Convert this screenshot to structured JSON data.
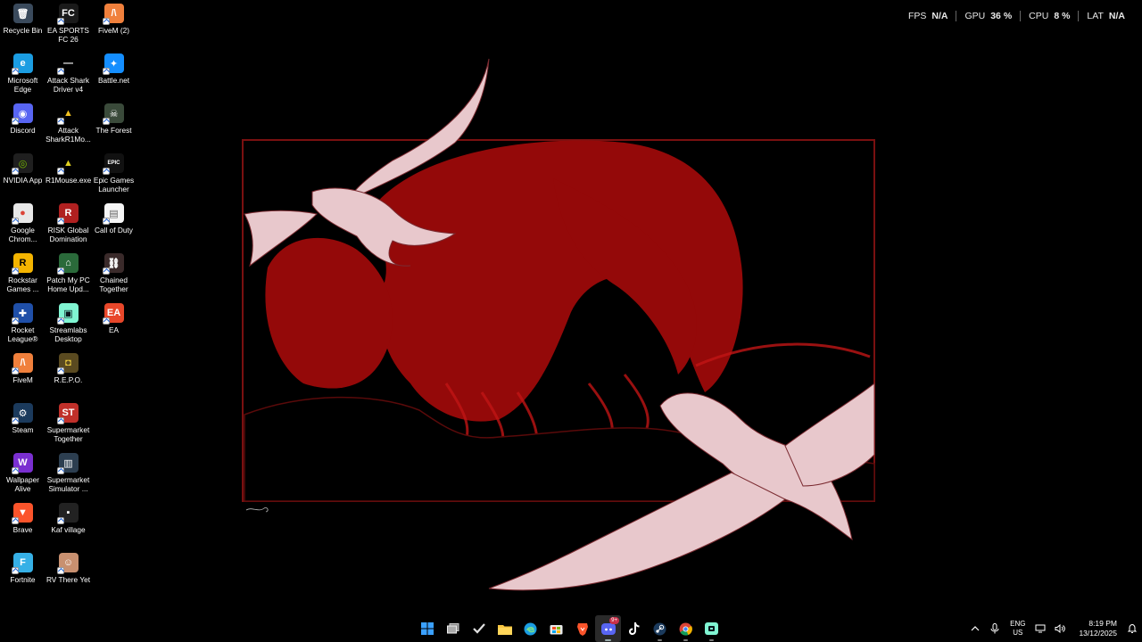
{
  "desktop": {
    "icons": [
      {
        "label": "Recycle Bin",
        "icon": "recycle-bin-icon",
        "bg": "#3a4a5c",
        "glyph": "🗑"
      },
      {
        "label": "Microsoft Edge",
        "icon": "edge-icon",
        "bg": "#1b9de2",
        "glyph": "e"
      },
      {
        "label": "Discord",
        "icon": "discord-icon",
        "bg": "#5865f2",
        "glyph": "◉"
      },
      {
        "label": "NVIDIA App",
        "icon": "nvidia-icon",
        "bg": "#1f1f1f",
        "glyph": "◎",
        "color": "#76b900"
      },
      {
        "label": "Google Chrom...",
        "icon": "chrome-icon",
        "bg": "#e8e8e8",
        "glyph": "●",
        "color": "#db4437"
      },
      {
        "label": "Rockstar Games ...",
        "icon": "rockstar-icon",
        "bg": "#f4b400",
        "glyph": "R",
        "color": "#000"
      },
      {
        "label": "Rocket League®",
        "icon": "rocket-league-icon",
        "bg": "#1f4fa8",
        "glyph": "✚"
      },
      {
        "label": "FiveM",
        "icon": "fivem-icon",
        "bg": "#f0803c",
        "glyph": "/\\"
      },
      {
        "label": "Steam",
        "icon": "steam-icon",
        "bg": "#1b3a5c",
        "glyph": "⚙"
      },
      {
        "label": "Wallpaper Alive",
        "icon": "wallpaper-alive-icon",
        "bg": "#7a2fd0",
        "glyph": "W"
      },
      {
        "label": "Brave",
        "icon": "brave-icon",
        "bg": "#fb542b",
        "glyph": "▼"
      },
      {
        "label": "Fortnite",
        "icon": "fortnite-icon",
        "bg": "#36b0e6",
        "glyph": "F"
      },
      {
        "label": "EA SPORTS FC 26",
        "icon": "ea-sports-fc-icon",
        "bg": "#1a1a1a",
        "glyph": "FC"
      },
      {
        "label": "Attack Shark Driver v4",
        "icon": "attack-shark-driver-icon",
        "bg": "#000",
        "glyph": "—"
      },
      {
        "label": "Attack SharkR1Mo...",
        "icon": "attack-shark-r1-icon",
        "bg": "#000",
        "glyph": "▲",
        "color": "#f0c020"
      },
      {
        "label": "R1Mouse.exe",
        "icon": "r1mouse-icon",
        "bg": "#000",
        "glyph": "▲",
        "color": "#e0d020"
      },
      {
        "label": "RISK Global Domination",
        "icon": "risk-icon",
        "bg": "#b02020",
        "glyph": "R"
      },
      {
        "label": "Patch My PC Home Upd...",
        "icon": "patch-my-pc-icon",
        "bg": "#2a6a3a",
        "glyph": "⌂"
      },
      {
        "label": "Streamlabs Desktop",
        "icon": "streamlabs-icon",
        "bg": "#80f5d2",
        "glyph": "▣",
        "color": "#09161d"
      },
      {
        "label": "R.E.P.O.",
        "icon": "repo-icon",
        "bg": "#5a4a20",
        "glyph": "◘",
        "color": "#f0d040"
      },
      {
        "label": "Supermarket Together",
        "icon": "supermarket-together-icon",
        "bg": "#c0302a",
        "glyph": "ST"
      },
      {
        "label": "Supermarket Simulator ...",
        "icon": "supermarket-simulator-icon",
        "bg": "#2c3e50",
        "glyph": "▥"
      },
      {
        "label": "Kaf village",
        "icon": "kaf-village-icon",
        "bg": "#222",
        "glyph": "▪"
      },
      {
        "label": "RV There Yet",
        "icon": "rv-there-yet-icon",
        "bg": "#c89070",
        "glyph": "☺"
      },
      {
        "label": "FiveM (2)",
        "icon": "fivem-icon",
        "bg": "#f0803c",
        "glyph": "/\\"
      },
      {
        "label": "Battle.net",
        "icon": "battlenet-icon",
        "bg": "#148eff",
        "glyph": "✦"
      },
      {
        "label": "The Forest",
        "icon": "the-forest-icon",
        "bg": "#3a4a3a",
        "glyph": "☠"
      },
      {
        "label": "Epic Games Launcher",
        "icon": "epic-games-icon",
        "bg": "#111",
        "glyph": "EPIC"
      },
      {
        "label": "Call of Duty",
        "icon": "document-icon",
        "bg": "#f5f5f5",
        "glyph": "▤",
        "color": "#666"
      },
      {
        "label": "Chained Together",
        "icon": "chained-together-icon",
        "bg": "#3a2a2a",
        "glyph": "⛓"
      },
      {
        "label": "EA",
        "icon": "ea-icon",
        "bg": "#e8472a",
        "glyph": "EA"
      }
    ]
  },
  "perf_overlay": {
    "fps_label": "FPS",
    "fps_value": "N/A",
    "gpu_label": "GPU",
    "gpu_value": "36 %",
    "cpu_label": "CPU",
    "cpu_value": "8 %",
    "lat_label": "LAT",
    "lat_value": "N/A"
  },
  "taskbar": {
    "apps": [
      {
        "name": "start-button",
        "icon": "windows-logo-icon",
        "state": ""
      },
      {
        "name": "task-view-button",
        "icon": "task-view-icon",
        "state": ""
      },
      {
        "name": "tasks-app-button",
        "icon": "checkmark-icon",
        "state": ""
      },
      {
        "name": "file-explorer-button",
        "icon": "folder-icon",
        "state": ""
      },
      {
        "name": "edge-taskbar-button",
        "icon": "edge-icon",
        "state": ""
      },
      {
        "name": "microsoft-store-button",
        "icon": "store-icon",
        "state": ""
      },
      {
        "name": "brave-taskbar-button",
        "icon": "brave-icon",
        "state": ""
      },
      {
        "name": "discord-taskbar-button",
        "icon": "discord-icon",
        "state": "active",
        "badge": "9+"
      },
      {
        "name": "tiktok-taskbar-button",
        "icon": "tiktok-icon",
        "state": ""
      },
      {
        "name": "steam-taskbar-button",
        "icon": "steam-icon",
        "state": "open"
      },
      {
        "name": "chrome-taskbar-button",
        "icon": "chrome-icon",
        "state": "open"
      },
      {
        "name": "streamlabs-taskbar-button",
        "icon": "streamlabs-icon",
        "state": "open"
      }
    ],
    "tray": {
      "lang_top": "ENG",
      "lang_bottom": "US",
      "time": "8:19 PM",
      "date": "13/12/2025"
    }
  }
}
